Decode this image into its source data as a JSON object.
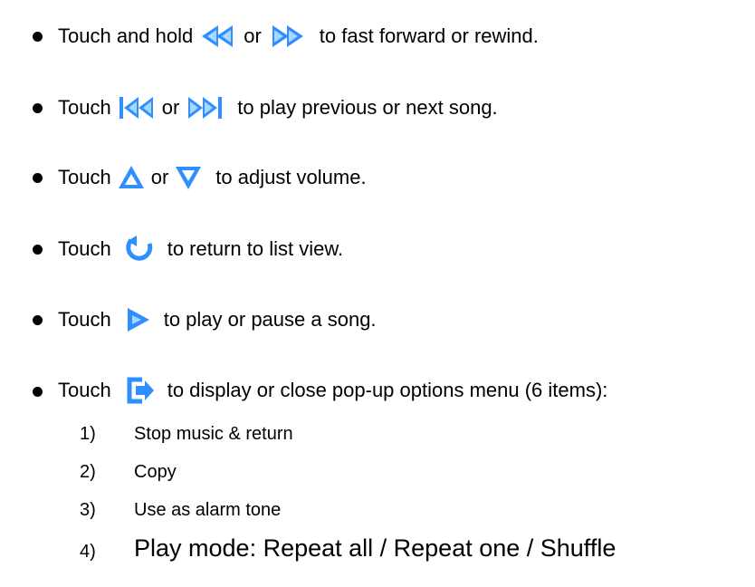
{
  "icons": {
    "rewind": "rewind-icon",
    "fast_forward": "fast-forward-icon",
    "volume_up": "volume-up-icon",
    "volume_down": "volume-down-icon",
    "return": "return-icon",
    "play": "play-icon",
    "menu": "menu-icon"
  },
  "colors": {
    "icon_blue": "#2f8fff",
    "icon_light": "#a7d6ff",
    "text": "#000000"
  },
  "lines": [
    {
      "touch": "Touch and hold",
      "or": "or",
      "rest": "to fast forward or rewind."
    },
    {
      "touch": "Touch",
      "or": "or",
      "rest": "to play previous or next song."
    },
    {
      "touch": "Touch",
      "or": "or",
      "rest": "to adjust volume."
    },
    {
      "touch": "Touch",
      "rest": "to return to list view."
    },
    {
      "touch": "Touch",
      "rest": "to play or pause a song."
    },
    {
      "touch": "Touch",
      "rest": "to display or close pop-up options menu (6 items):"
    }
  ],
  "menu_items": [
    {
      "num": "1)",
      "label": "Stop music & return"
    },
    {
      "num": "2)",
      "label": "Copy"
    },
    {
      "num": "3)",
      "label": "Use as alarm tone"
    },
    {
      "num": "4)",
      "label": "Play mode: Repeat all / Repeat one / Shuffle"
    }
  ]
}
